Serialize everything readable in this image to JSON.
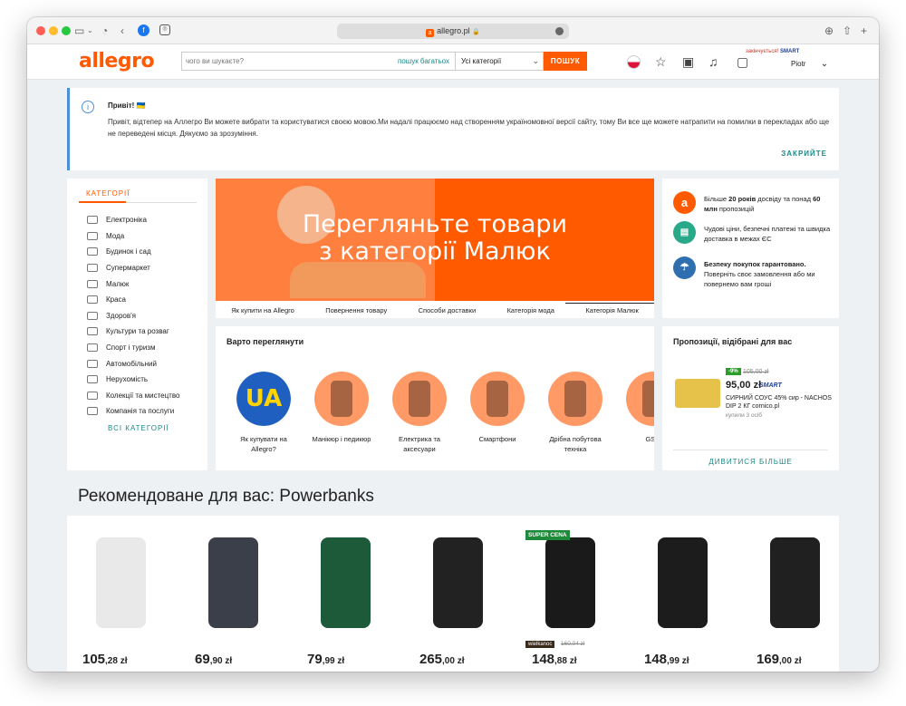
{
  "browser": {
    "url": "allegro.pl"
  },
  "header": {
    "logo": "allegro",
    "search_placeholder": "чого ви шукаєте?",
    "search_many": "пошук багатьох",
    "category_select": "Усі категорії",
    "search_button": "ПОШУК",
    "smart_promo": "закінчується!",
    "smart_label": "SMART",
    "user_name": "Piotr"
  },
  "banner": {
    "title": "Привіт! 🇺🇦",
    "text": "Привіт, відтепер на Аллегро Ви можете вибрати та користуватися своєю мовою.Ми надалі працюємо над створенням україномовної версії сайту, тому Ви все ще можете натрапити на помилки в перекладах або ще не переведені місця. Дякуємо за зрозуміння.",
    "close": "ЗАКРИЙТЕ"
  },
  "categories": {
    "title": "КАТЕГОРІЇ",
    "items": [
      {
        "label": "Електроніка"
      },
      {
        "label": "Мода"
      },
      {
        "label": "Будинок і сад"
      },
      {
        "label": "Супермаркет"
      },
      {
        "label": "Малюк"
      },
      {
        "label": "Краса"
      },
      {
        "label": "Здоров'я"
      },
      {
        "label": "Культури та розваг"
      },
      {
        "label": "Спорт і туризм"
      },
      {
        "label": "Автомобільний"
      },
      {
        "label": "Нерухомість"
      },
      {
        "label": "Колекції та мистецтво"
      },
      {
        "label": "Компанія та послуги"
      }
    ],
    "all": "ВСІ КАТЕГОРІЇ"
  },
  "hero": {
    "line1": "Перегляньте товари",
    "line2": "з категорії Малюк",
    "links": [
      "Як купити на Allegro",
      "Повернення товару",
      "Способи доставки",
      "Категорія мода",
      "Категорія Малюк"
    ]
  },
  "trust": {
    "row1_pre": "Більше ",
    "row1_b1": "20 років",
    "row1_mid": " досвіду та понад ",
    "row1_b2": "60 млн",
    "row1_post": " пропозицій",
    "row2": "Чудові ціни, безпечні платежі та швидка доставка в межах ЄС",
    "row3_b": "Безпеку покупок гарантовано.",
    "row3": "Поверніть своє замовлення або ми повернемо вам гроші"
  },
  "worth": {
    "title": "Варто переглянути",
    "items": [
      {
        "label": "Як купувати на Allegro?",
        "badge": "UA"
      },
      {
        "label": "Манікюр і педикюр"
      },
      {
        "label": "Електрика та аксесуари"
      },
      {
        "label": "Смартфони"
      },
      {
        "label": "Дрібна побутова техніка"
      },
      {
        "label": "GSM"
      }
    ]
  },
  "offers": {
    "title": "Пропозиції, відібрані для вас",
    "discount": "-9%",
    "old_price": "105,00 zł",
    "price": "95,00 zł",
    "smart": "SMART",
    "name": "СИРНИЙ СОУС 45% сир - NACHOS DIP 2 КГ cornico.pl",
    "bought": "купили 3 осіб",
    "more": "ДИВИТИСЯ БІЛЬШЕ"
  },
  "recommended": {
    "title": "Рекомендоване для вас: Powerbanks",
    "products": [
      {
        "int": "105",
        "dec": ",28 zł"
      },
      {
        "int": "69",
        "dec": ",90 zł"
      },
      {
        "int": "79",
        "dec": ",99 zł"
      },
      {
        "int": "265",
        "dec": ",00 zł"
      },
      {
        "int": "148",
        "dec": ",88 zł",
        "super": "SUPER CENA",
        "tag": "wielkanoc",
        "old": "160,04 zł"
      },
      {
        "int": "148",
        "dec": ",99 zł"
      },
      {
        "int": "169",
        "dec": ",00 zł"
      }
    ]
  },
  "colors": {
    "brand": "#ff5a00",
    "link": "#1a8a8a",
    "info": "#4a90d9"
  }
}
